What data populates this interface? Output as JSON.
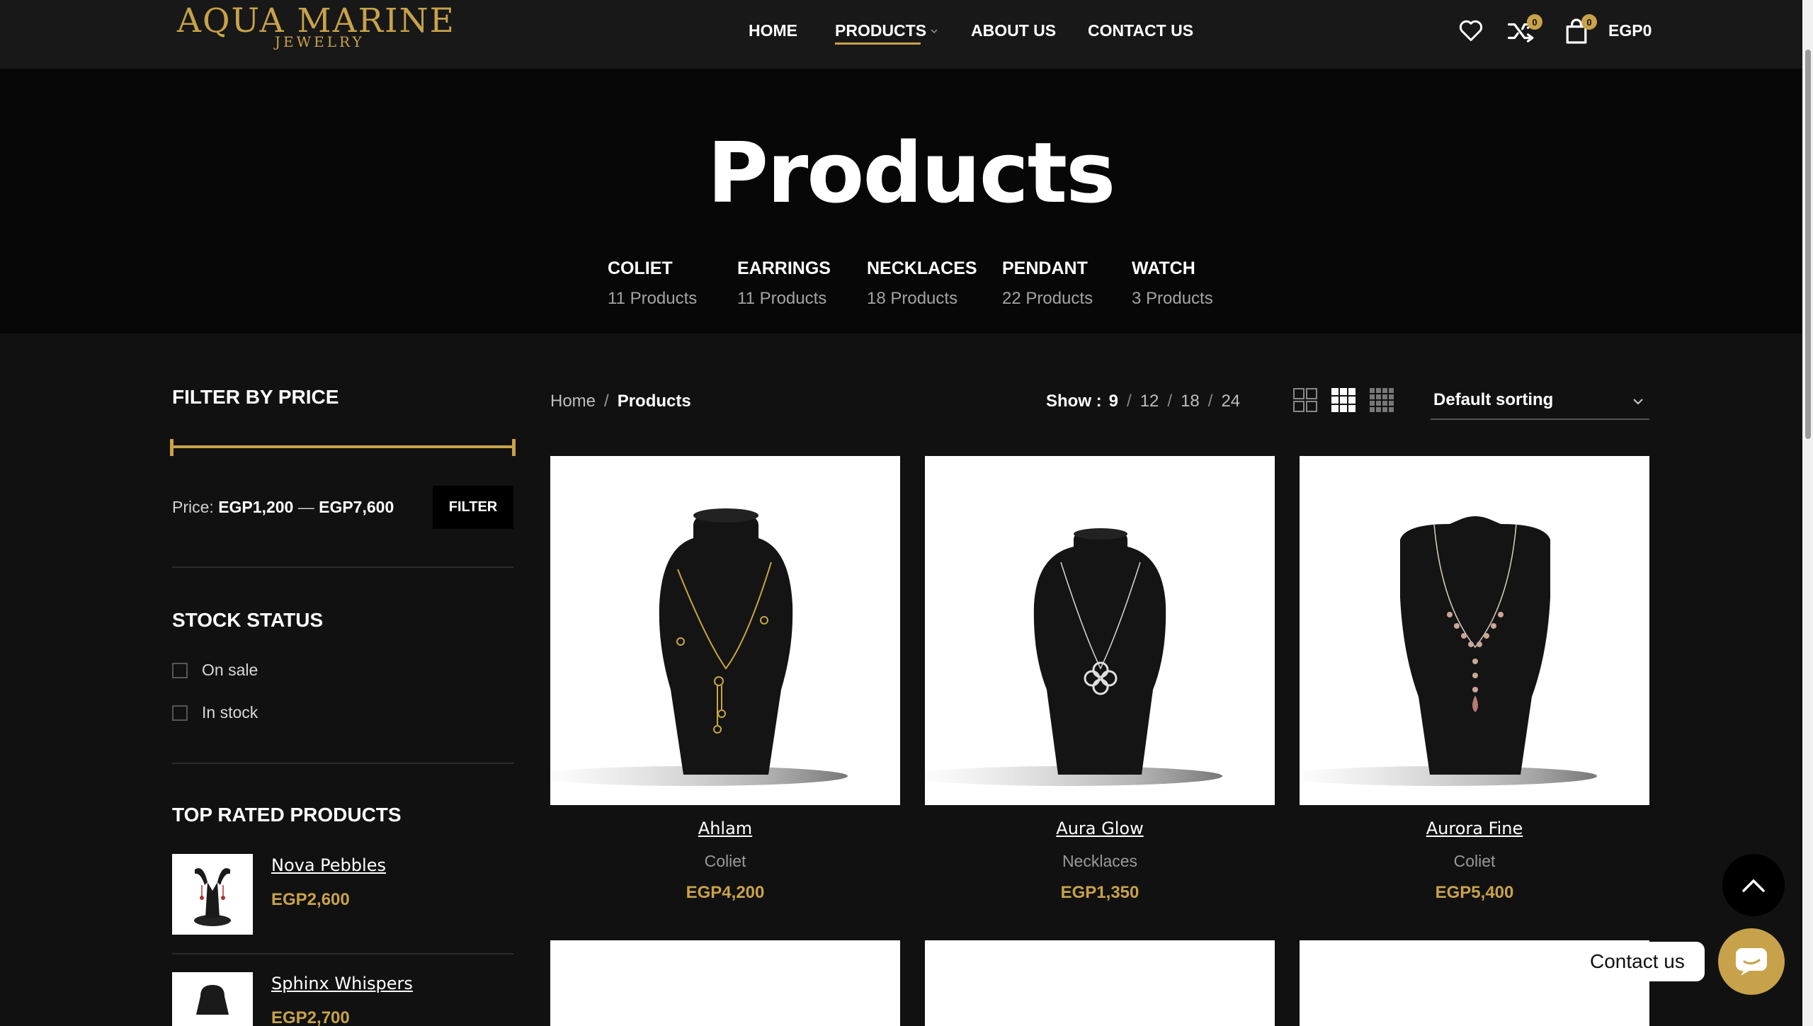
{
  "brand": {
    "name": "AQUA MARINE",
    "tagline": "JEWELRY"
  },
  "nav": {
    "home": "HOME",
    "products": "PRODUCTS",
    "about": "ABOUT US",
    "contact": "CONTACT US"
  },
  "header": {
    "wishlist_icon": "heart-icon",
    "compare_count": "0",
    "cart_count": "0",
    "cart_total": "EGP0"
  },
  "hero": {
    "title": "Products",
    "categories": [
      {
        "name": "COLIET",
        "count": "11 Products"
      },
      {
        "name": "EARRINGS",
        "count": "11 Products"
      },
      {
        "name": "NECKLACES",
        "count": "18 Products"
      },
      {
        "name": "PENDANT",
        "count": "22 Products"
      },
      {
        "name": "WATCH",
        "count": "3 Products"
      }
    ]
  },
  "sidebar": {
    "filter_price_title": "FILTER BY PRICE",
    "price_label": "Price:",
    "price_min": "EGP1,200",
    "price_dash": "—",
    "price_max": "EGP7,600",
    "filter_button": "FILTER",
    "stock_title": "STOCK STATUS",
    "stock_options": [
      {
        "label": "On sale",
        "checked": false
      },
      {
        "label": "In stock",
        "checked": false
      }
    ],
    "top_rated_title": "TOP RATED PRODUCTS",
    "top_rated": [
      {
        "name": "Nova Pebbles",
        "price": "EGP2,600"
      },
      {
        "name": "Sphinx Whispers",
        "price": "EGP2,700"
      }
    ]
  },
  "toolbar": {
    "breadcrumb_home": "Home",
    "breadcrumb_sep": "/",
    "breadcrumb_current": "Products",
    "show_label": "Show :",
    "show_options": [
      "9",
      "12",
      "18",
      "24"
    ],
    "show_selected": "9",
    "sort_label": "Default sorting"
  },
  "products": [
    {
      "name": "Ahlam",
      "category": "Coliet",
      "price": "EGP4,200"
    },
    {
      "name": "Aura Glow",
      "category": "Necklaces",
      "price": "EGP1,350"
    },
    {
      "name": "Aurora Fine",
      "category": "Coliet",
      "price": "EGP5,400"
    }
  ],
  "floating": {
    "contact_label": "Contact us"
  },
  "colors": {
    "accent": "#c8a24a",
    "background": "#111111",
    "hero_bg": "#070707"
  }
}
